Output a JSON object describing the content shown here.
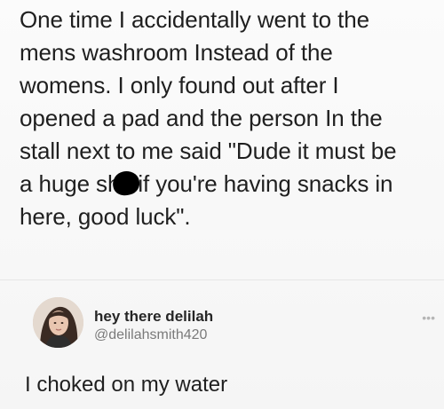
{
  "post": {
    "lines": [
      "One time I accidentally went to the",
      "mens washroom Instead of the",
      "womens. I only found out after I",
      "opened a pad and the person In the",
      "stall next to me said \"Dude it must be"
    ],
    "line6_before": "a huge sh",
    "line6_after": "if you're having snacks in",
    "line7": "here, good luck\"."
  },
  "comment": {
    "display_name": "hey there delilah",
    "handle": "@delilahsmith420",
    "more_label": "•••",
    "avatar_icon": "profile-photo",
    "text": "I choked on my water"
  },
  "colors": {
    "background": "#f8f8f8",
    "text": "#1f1f1f",
    "muted": "#7a7a7a"
  }
}
